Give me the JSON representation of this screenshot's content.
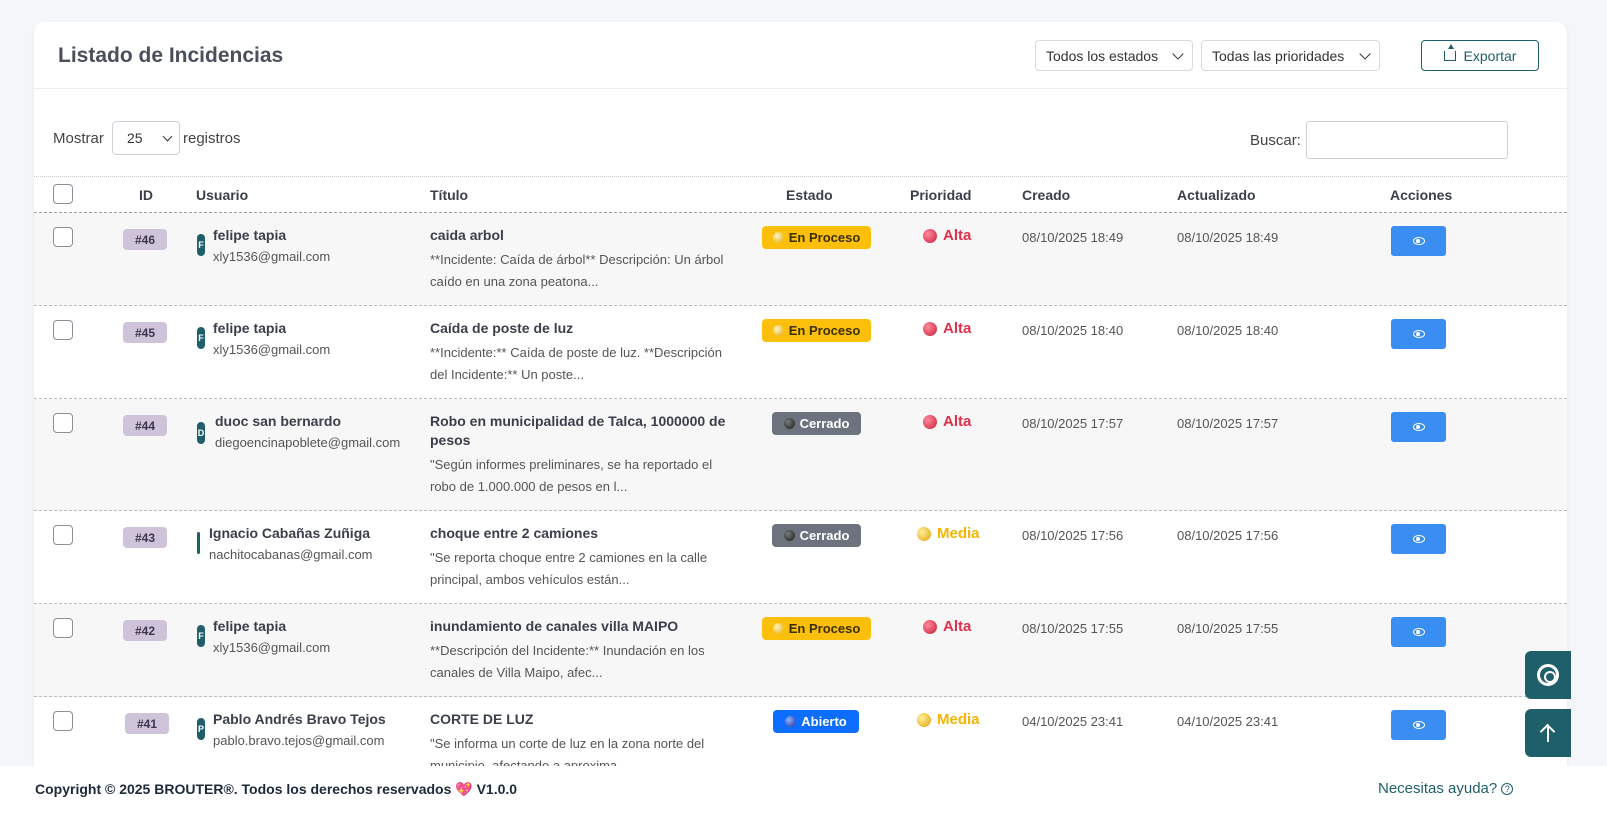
{
  "header": {
    "title": "Listado de Incidencias",
    "status_filter": "Todos los estados",
    "priority_filter": "Todas las prioridades",
    "export_label": "Exportar"
  },
  "controls": {
    "show_label": "Mostrar",
    "page_length": "25",
    "records_label": "registros",
    "search_label": "Buscar:",
    "search_value": ""
  },
  "columns": {
    "id": "ID",
    "user": "Usuario",
    "title": "Título",
    "status": "Estado",
    "priority": "Prioridad",
    "created": "Creado",
    "updated": "Actualizado",
    "actions": "Acciones"
  },
  "rows": [
    {
      "id": "#46",
      "initial": "F",
      "user_name": "felipe tapia",
      "user_email": "xly1536@gmail.com",
      "title": "caida arbol",
      "description": "**Incidente: Caída de árbol** Descripción: Un árbol caído en una zona peatona...",
      "status": "En Proceso",
      "priority": "Alta",
      "created": "08/10/2025 18:49",
      "updated": "08/10/2025 18:49"
    },
    {
      "id": "#45",
      "initial": "F",
      "user_name": "felipe tapia",
      "user_email": "xly1536@gmail.com",
      "title": "Caída de poste de luz",
      "description": "**Incidente:** Caída de poste de luz. **Descripción del Incidente:** Un poste...",
      "status": "En Proceso",
      "priority": "Alta",
      "created": "08/10/2025 18:40",
      "updated": "08/10/2025 18:40"
    },
    {
      "id": "#44",
      "initial": "D",
      "user_name": "duoc san bernardo",
      "user_email": "diegoencinapoblete@gmail.com",
      "title": "Robo en municipalidad de Talca, 1000000 de pesos",
      "description": "\"Según informes preliminares, se ha reportado el robo de 1.000.000 de pesos en l...",
      "status": "Cerrado",
      "priority": "Alta",
      "created": "08/10/2025 17:57",
      "updated": "08/10/2025 17:57"
    },
    {
      "id": "#43",
      "initial": "I",
      "user_name": "Ignacio Cabañas Zuñiga",
      "user_email": "nachitocabanas@gmail.com",
      "title": "choque entre 2 camiones",
      "description": "\"Se reporta choque entre 2 camiones en la calle principal, ambos vehículos están...",
      "status": "Cerrado",
      "priority": "Media",
      "created": "08/10/2025 17:56",
      "updated": "08/10/2025 17:56"
    },
    {
      "id": "#42",
      "initial": "F",
      "user_name": "felipe tapia",
      "user_email": "xly1536@gmail.com",
      "title": "inundamiento de canales villa MAIPO",
      "description": "**Descripción del Incidente:** Inundación en los canales de Villa Maipo, afec...",
      "status": "En Proceso",
      "priority": "Alta",
      "created": "08/10/2025 17:55",
      "updated": "08/10/2025 17:55"
    },
    {
      "id": "#41",
      "initial": "P",
      "user_name": "Pablo Andrés Bravo Tejos",
      "user_email": "pablo.bravo.tejos@gmail.com",
      "title": "CORTE DE LUZ",
      "description": "\"Se informa un corte de luz en la zona norte del municipio, afectando a aproxima...",
      "status": "Abierto",
      "priority": "Media",
      "created": "04/10/2025 23:41",
      "updated": "04/10/2025 23:41"
    }
  ],
  "footer": {
    "copyright": "Copyright © 2025 BROUTER®. Todos los derechos reservados",
    "heart": "💖",
    "version": "V1.0.0",
    "help": "Necesitas ayuda?"
  },
  "colors": {
    "brand": "#1f5f6a",
    "status_in_progress": "#fbbf0c",
    "status_closed": "#6c737e",
    "status_open": "#0d6efd",
    "priority_high": "#e0304a",
    "priority_medium": "#f5b500",
    "view_button": "#3a8ef1",
    "id_badge": "#cfc3da"
  },
  "icons": {
    "export": "upload-tray-icon",
    "view": "eye-icon",
    "settings": "gear-icon",
    "back_to_top": "arrow-up-icon",
    "help": "question-circle-icon"
  }
}
